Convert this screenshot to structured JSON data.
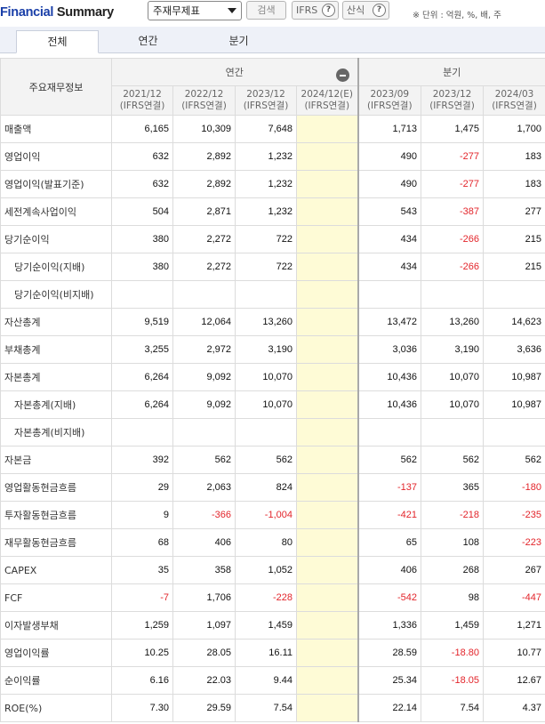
{
  "header": {
    "title_part1": "Financial",
    "title_part2": "Summary",
    "report_select": "주재무제표",
    "search_label": "검색",
    "ifrs_label": "IFRS",
    "calc_label": "산식",
    "help_icon_glyph": "?",
    "unit_text": "※ 단위 : 억원, %, 배, 주"
  },
  "tabs": [
    {
      "label": "전체",
      "active": true
    },
    {
      "label": "연간",
      "active": false
    },
    {
      "label": "분기",
      "active": false
    }
  ],
  "table": {
    "corner_label": "주요재무정보",
    "annual_group_label": "연간",
    "quarter_group_label": "분기",
    "columns": [
      {
        "period": "2021/12",
        "basis": "(IFRS연결)"
      },
      {
        "period": "2022/12",
        "basis": "(IFRS연결)"
      },
      {
        "period": "2023/12",
        "basis": "(IFRS연결)"
      },
      {
        "period": "2024/12(E)",
        "basis": "(IFRS연결)"
      },
      {
        "period": "2023/09",
        "basis": "(IFRS연결)"
      },
      {
        "period": "2023/12",
        "basis": "(IFRS연결)"
      },
      {
        "period": "2024/03",
        "basis": "(IFRS연결)"
      }
    ],
    "rows": [
      {
        "label": "매출액",
        "values": [
          "6,165",
          "10,309",
          "7,648",
          "",
          "1,713",
          "1,475",
          "1,700"
        ]
      },
      {
        "label": "영업이익",
        "values": [
          "632",
          "2,892",
          "1,232",
          "",
          "490",
          "-277",
          "183"
        ]
      },
      {
        "label": "영업이익(발표기준)",
        "values": [
          "632",
          "2,892",
          "1,232",
          "",
          "490",
          "-277",
          "183"
        ]
      },
      {
        "label": "세전계속사업이익",
        "values": [
          "504",
          "2,871",
          "1,232",
          "",
          "543",
          "-387",
          "277"
        ]
      },
      {
        "label": "당기순이익",
        "values": [
          "380",
          "2,272",
          "722",
          "",
          "434",
          "-266",
          "215"
        ]
      },
      {
        "label": "당기순이익(지배)",
        "values": [
          "380",
          "2,272",
          "722",
          "",
          "434",
          "-266",
          "215"
        ]
      },
      {
        "label": "당기순이익(비지배)",
        "values": [
          "",
          "",
          "",
          "",
          "",
          "",
          ""
        ]
      },
      {
        "label": "자산총계",
        "values": [
          "9,519",
          "12,064",
          "13,260",
          "",
          "13,472",
          "13,260",
          "14,623"
        ]
      },
      {
        "label": "부채총계",
        "values": [
          "3,255",
          "2,972",
          "3,190",
          "",
          "3,036",
          "3,190",
          "3,636"
        ]
      },
      {
        "label": "자본총계",
        "values": [
          "6,264",
          "9,092",
          "10,070",
          "",
          "10,436",
          "10,070",
          "10,987"
        ]
      },
      {
        "label": "자본총계(지배)",
        "values": [
          "6,264",
          "9,092",
          "10,070",
          "",
          "10,436",
          "10,070",
          "10,987"
        ]
      },
      {
        "label": "자본총계(비지배)",
        "values": [
          "",
          "",
          "",
          "",
          "",
          "",
          ""
        ]
      },
      {
        "label": "자본금",
        "values": [
          "392",
          "562",
          "562",
          "",
          "562",
          "562",
          "562"
        ]
      },
      {
        "label": "영업활동현금흐름",
        "values": [
          "29",
          "2,063",
          "824",
          "",
          "-137",
          "365",
          "-180"
        ]
      },
      {
        "label": "투자활동현금흐름",
        "values": [
          "9",
          "-366",
          "-1,004",
          "",
          "-421",
          "-218",
          "-235"
        ]
      },
      {
        "label": "재무활동현금흐름",
        "values": [
          "68",
          "406",
          "80",
          "",
          "65",
          "108",
          "-223"
        ]
      },
      {
        "label": "CAPEX",
        "values": [
          "35",
          "358",
          "1,052",
          "",
          "406",
          "268",
          "267"
        ]
      },
      {
        "label": "FCF",
        "values": [
          "-7",
          "1,706",
          "-228",
          "",
          "-542",
          "98",
          "-447"
        ]
      },
      {
        "label": "이자발생부채",
        "values": [
          "1,259",
          "1,097",
          "1,459",
          "",
          "1,336",
          "1,459",
          "1,271"
        ]
      },
      {
        "label": "영업이익률",
        "values": [
          "10.25",
          "28.05",
          "16.11",
          "",
          "28.59",
          "-18.80",
          "10.77"
        ]
      },
      {
        "label": "순이익률",
        "values": [
          "6.16",
          "22.03",
          "9.44",
          "",
          "25.34",
          "-18.05",
          "12.67"
        ]
      },
      {
        "label": "ROE(%)",
        "values": [
          "7.30",
          "29.59",
          "7.54",
          "",
          "22.14",
          "7.54",
          "4.37"
        ]
      }
    ],
    "sub_rows": [
      5,
      6,
      10,
      11
    ]
  },
  "colors": {
    "title_accent": "#1a3fa8",
    "negative": "#e3252b",
    "estimate_fill": "#fefbd6"
  },
  "icons": {
    "select_chevron": "chevron-down-icon",
    "help": "question-circle-icon",
    "collapse": "minus-circle-icon"
  }
}
